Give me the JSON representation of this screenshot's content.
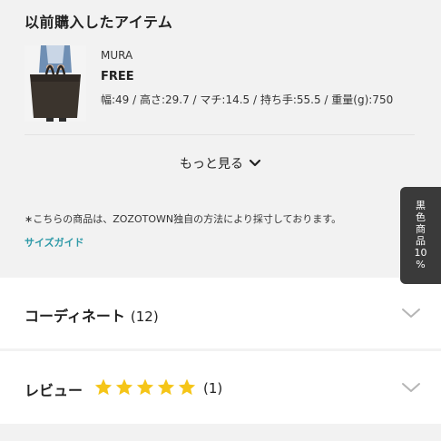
{
  "section": {
    "title": "以前購入したアイテム"
  },
  "item": {
    "brand": "MURA",
    "size": "FREE",
    "dimensions": "幅:49 / 高さ:29.7 / マチ:14.5 / 持ち手:55.5 / 重量(g):750",
    "thumbnail_icon": "tote-bag-photo"
  },
  "more": {
    "label": "もっと見る",
    "icon": "chevron-down-icon"
  },
  "note": "∗こちらの商品は、ZOZOTOWN独自の方法により採寸しております。",
  "size_guide": "サイズガイド",
  "coordinate": {
    "label": "コーディネート",
    "count": "(12)"
  },
  "review": {
    "label": "レビュー",
    "rating": 5,
    "max_rating": 5,
    "count": "(1)"
  },
  "side_tab": {
    "chars": [
      "黒",
      "色",
      "商",
      "品",
      "10",
      "%"
    ]
  },
  "colors": {
    "link": "#2f9aa8",
    "star": "#f5c518",
    "side_tab_bg": "#3a3a3a"
  }
}
